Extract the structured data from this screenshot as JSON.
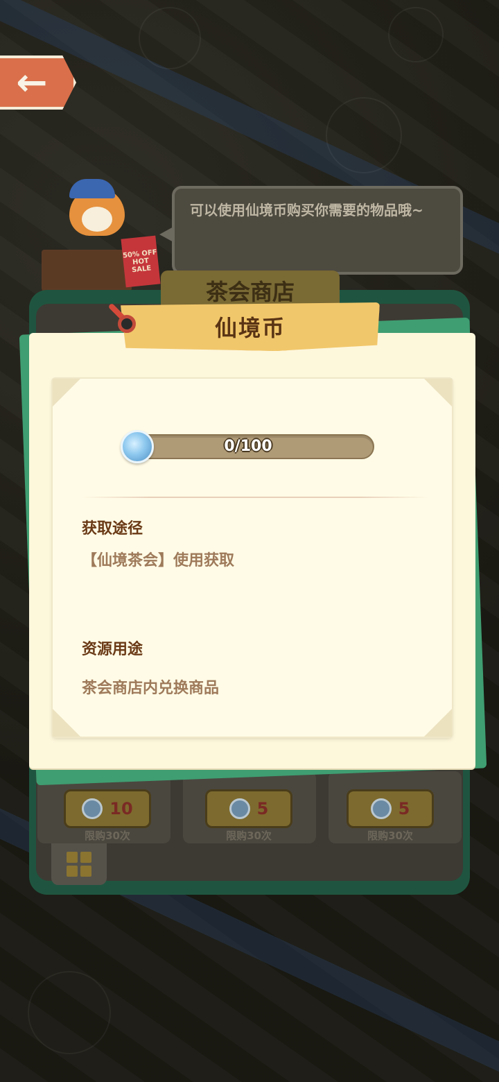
{
  "npc": {
    "speech": "可以使用仙境币购买你需要的物品哦~",
    "sale_badge": "50% OFF",
    "sale_word_1": "HOT",
    "sale_word_2": "SALE"
  },
  "shop": {
    "title": "茶会商店",
    "items": [
      {
        "price": "10",
        "limit": "限购30次"
      },
      {
        "price": "5",
        "limit": "限购30次"
      },
      {
        "price": "5",
        "limit": "限购30次"
      }
    ]
  },
  "popup": {
    "title": "仙境币",
    "progress": {
      "current": 0,
      "max": 100,
      "text": "0/100"
    },
    "obtain_heading": "获取途径",
    "obtain_text": "【仙境茶会】使用获取",
    "usage_heading": "资源用途",
    "usage_text": "茶会商店内兑换商品"
  },
  "colors": {
    "popup_bg": "#fdf7dc",
    "header_bg": "#f1c76b",
    "heading_text": "#6a3a16",
    "body_text": "#9e7a5a",
    "shop_frame": "#1f5540",
    "popup_back_green": "#3f9e72"
  },
  "icons": {
    "back": "arrow-left-icon",
    "coin": "fairyland-coin-icon",
    "menu": "grid-icon"
  }
}
